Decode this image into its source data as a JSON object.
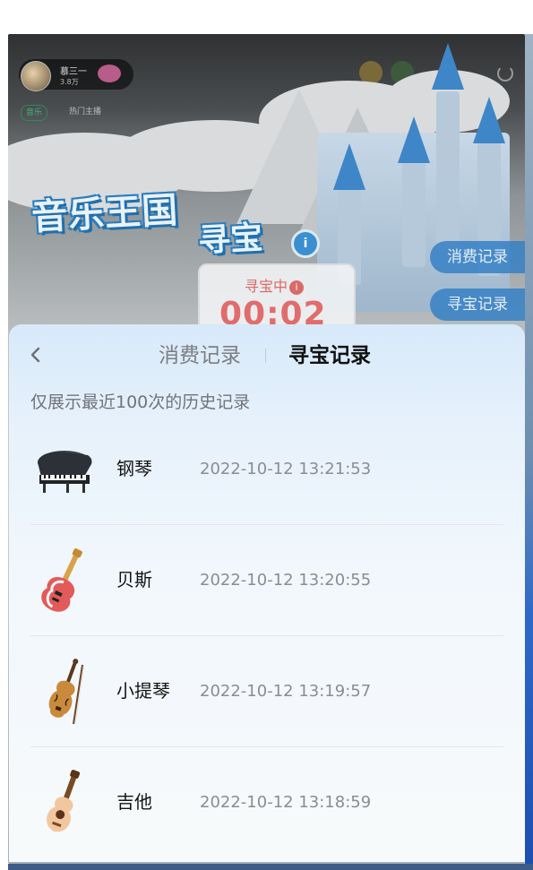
{
  "background": {
    "host_name": "慕三一",
    "host_fans": "3.8万",
    "tag_music": "音乐",
    "tag_hot": "热门主播",
    "game_title_line1": "音乐王国",
    "game_title_line2": "寻宝",
    "info_glyph": "i",
    "hunt_status": "寻宝中",
    "hunt_timer": "00:02",
    "side_buttons": [
      "消费记录",
      "寻宝记录"
    ]
  },
  "sheet": {
    "tabs": [
      {
        "label": "消费记录",
        "active": false
      },
      {
        "label": "寻宝记录",
        "active": true
      }
    ],
    "notice": "仅展示最近100次的历史记录",
    "records": [
      {
        "name": "钢琴",
        "time": "2022-10-12 13:21:53",
        "icon": "piano-icon"
      },
      {
        "name": "贝斯",
        "time": "2022-10-12 13:20:55",
        "icon": "bass-guitar-icon"
      },
      {
        "name": "小提琴",
        "time": "2022-10-12 13:19:57",
        "icon": "violin-icon"
      },
      {
        "name": "吉他",
        "time": "2022-10-12 13:18:59",
        "icon": "ukulele-guitar-icon"
      }
    ]
  },
  "colors": {
    "active_tab": "#111111",
    "inactive_tab": "#7b7e82",
    "sheet_top": "#d7e9fa",
    "timer_red": "#e06c6c",
    "side_button_blue": "#3680c4"
  }
}
